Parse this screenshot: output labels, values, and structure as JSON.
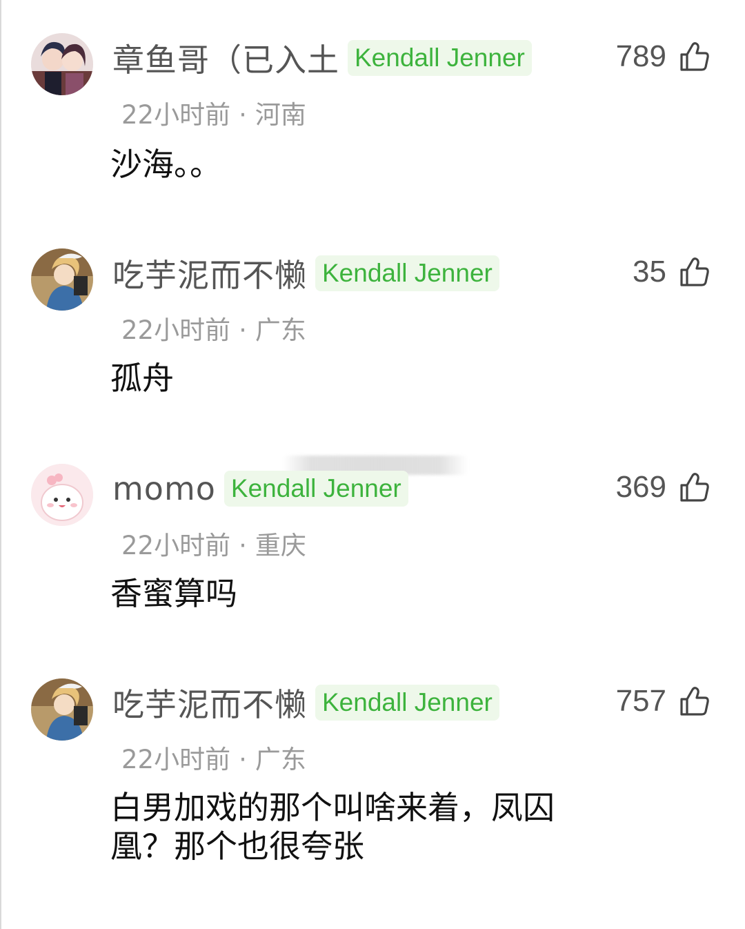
{
  "comments": [
    {
      "username": "章鱼哥（已入土",
      "badge": "Kendall Jenner",
      "time": "22小时前",
      "dot": "·",
      "location": "河南",
      "likes": "789",
      "text": "沙海。。",
      "avatar_icon": "anime-couple-avatar-icon"
    },
    {
      "username": "吃芋泥而不懒",
      "badge": "Kendall Jenner",
      "time": "22小时前",
      "dot": "·",
      "location": "广东",
      "likes": "35",
      "text": "孤舟",
      "avatar_icon": "painted-portrait-avatar-icon"
    },
    {
      "username": "momo",
      "badge": "Kendall Jenner",
      "time": "22小时前",
      "dot": "·",
      "location": "重庆",
      "likes": "369",
      "text": "香蜜算吗",
      "avatar_icon": "pink-cartoon-avatar-icon"
    },
    {
      "username": "吃芋泥而不懒",
      "badge": "Kendall Jenner",
      "time": "22小时前",
      "dot": "·",
      "location": "广东",
      "likes": "757",
      "text_line1": "白男加戏的那个叫啥来着，凤囚",
      "text_line2": "凰？那个也很夸张",
      "avatar_icon": "painted-portrait-avatar-icon"
    }
  ],
  "colors": {
    "badge_bg": "#eef8ea",
    "badge_text": "#3db33d",
    "username": "#555555",
    "meta": "#9a9a9a",
    "content": "#111111"
  },
  "icons": {
    "like": "thumbs-up-icon"
  }
}
